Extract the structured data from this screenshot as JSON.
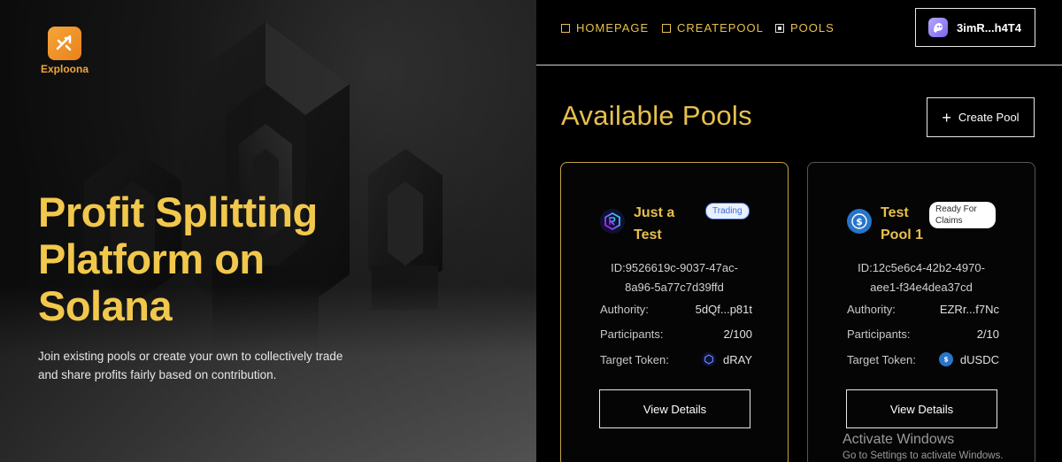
{
  "brand": {
    "name": "Exploona",
    "color": "#f0a440"
  },
  "hero": {
    "title_lines": [
      "Profit Splitting",
      "Platform on",
      "Solana"
    ],
    "subtitle": "Join existing pools or create your own to collectively trade and share profits fairly based on contribution.",
    "accent_color": "#f2c84c"
  },
  "nav": {
    "items": [
      {
        "label": "HOMEPAGE",
        "active": false
      },
      {
        "label": "CREATEPOOL",
        "active": false
      },
      {
        "label": "POOLS",
        "active": true
      }
    ],
    "wallet_label": "3imR...h4T4",
    "wallet_icon": "wallet-ghost-icon"
  },
  "pools": {
    "title": "Available Pools",
    "create_label": "Create Pool",
    "create_icon": "plus-icon",
    "cards": [
      {
        "name": "Just a Test",
        "badge": "Trading",
        "token_icon": "raydium-icon",
        "id_line1": "ID:9526619c-9037-47ac-",
        "id_line2": "8a96-5a77c7d39ffd",
        "authority_label": "Authority:",
        "authority_value": "5dQf...p81t",
        "participants_label": "Participants:",
        "participants_value": "2/100",
        "target_label": "Target Token:",
        "target_value": "dRAY",
        "button_label": "View Details"
      },
      {
        "name": "Test Pool 1",
        "badge": "Ready For Claims",
        "token_icon": "usdc-icon",
        "id_line1": "ID:12c5e6c4-42b2-4970-",
        "id_line2": "aee1-f34e4dea37cd",
        "authority_label": "Authority:",
        "authority_value": "EZRr...f7Nc",
        "participants_label": "Participants:",
        "participants_value": "2/10",
        "target_label": "Target Token:",
        "target_value": "dUSDC",
        "button_label": "View Details"
      }
    ]
  },
  "watermark": {
    "line1": "Activate Windows",
    "line2": "Go to Settings to activate Windows."
  }
}
